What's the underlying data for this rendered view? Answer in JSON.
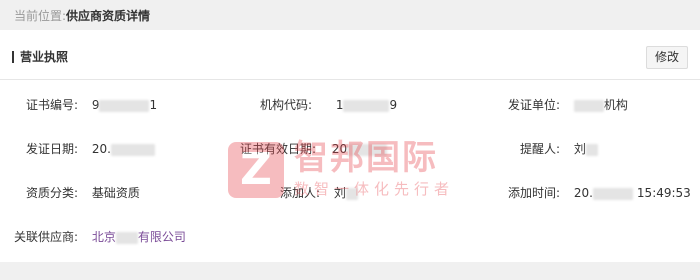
{
  "breadcrumb": {
    "prefix": "当前位置:",
    "current": "供应商资质详情"
  },
  "section": {
    "title": "营业执照",
    "edit_label": "修改"
  },
  "fields": {
    "cert_no": {
      "label": "证书编号:",
      "value_start": "9",
      "value_end": "1"
    },
    "org_code": {
      "label": "机构代码:",
      "value_start": "1",
      "value_end": "9"
    },
    "issuer": {
      "label": "发证单位:",
      "value_end": "机构"
    },
    "issue_date": {
      "label": "发证日期:",
      "value_start": "20."
    },
    "valid_date": {
      "label": "证书有效日期:",
      "value_start": "20"
    },
    "reminder": {
      "label": "提醒人:",
      "value_start": "刘"
    },
    "category": {
      "label": "资质分类:",
      "value": "基础资质"
    },
    "adder": {
      "label": "添加人:",
      "value_start": "刘"
    },
    "add_time": {
      "label": "添加时间:",
      "value_start": "20.",
      "value_end": "15:49:53"
    },
    "supplier": {
      "label": "关联供应商:",
      "value_start": "北京",
      "value_end": "有限公司"
    }
  },
  "watermark": {
    "title": "智邦国际",
    "subtitle": "数智一体化先行者",
    "logo_letter": "Z"
  },
  "colors": {
    "link": "#7a4b97",
    "watermark": "#e8434a"
  }
}
